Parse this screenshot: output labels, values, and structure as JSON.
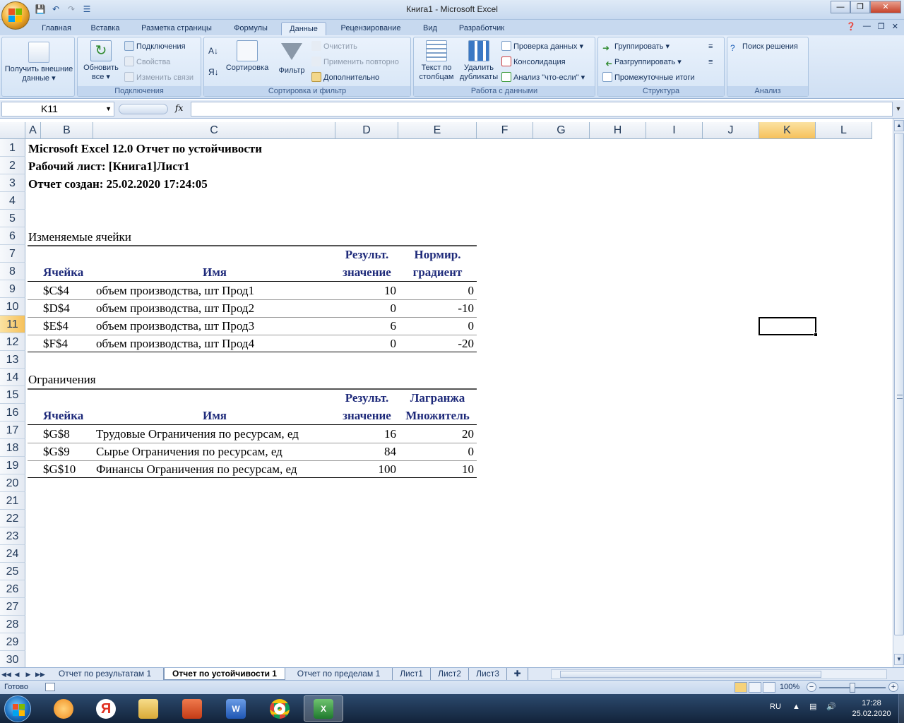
{
  "window": {
    "title": "Книга1 - Microsoft Excel",
    "qat_icons": [
      "save-icon",
      "undo-icon",
      "redo-icon",
      "customize-icon"
    ]
  },
  "ribbon_tabs": [
    "Главная",
    "Вставка",
    "Разметка страницы",
    "Формулы",
    "Данные",
    "Рецензирование",
    "Вид",
    "Разработчик"
  ],
  "active_tab": "Данные",
  "ribbon": {
    "get_external": "Получить внешние данные",
    "refresh_all": "Обновить все",
    "connections": "Подключения",
    "properties": "Свойства",
    "edit_links": "Изменить связи",
    "group_connections": "Подключения",
    "sort": "Сортировка",
    "filter": "Фильтр",
    "clear": "Очистить",
    "reapply": "Применить повторно",
    "advanced": "Дополнительно",
    "group_sort": "Сортировка и фильтр",
    "text_to_columns": "Текст по столбцам",
    "remove_duplicates": "Удалить дубликаты",
    "data_validation": "Проверка данных",
    "consolidate": "Консолидация",
    "what_if": "Анализ \"что-если\"",
    "group_data_tools": "Работа с данными",
    "group": "Группировать",
    "ungroup": "Разгруппировать",
    "subtotal": "Промежуточные итоги",
    "group_outline": "Структура",
    "solver": "Поиск решения",
    "group_analysis": "Анализ"
  },
  "formula_bar": {
    "name_box": "K11",
    "fx": "fx",
    "formula": ""
  },
  "columns": [
    "A",
    "B",
    "C",
    "D",
    "E",
    "F",
    "G",
    "H",
    "I",
    "J",
    "K",
    "L"
  ],
  "selected_column": "K",
  "rows": [
    "1",
    "2",
    "3",
    "4",
    "5",
    "6",
    "7",
    "8",
    "9",
    "10",
    "11",
    "12",
    "13",
    "14",
    "15",
    "16",
    "17",
    "18",
    "19",
    "20",
    "21",
    "22",
    "23",
    "24",
    "25",
    "26",
    "27",
    "28",
    "29",
    "30"
  ],
  "selected_row": "11",
  "report": {
    "title1": "Microsoft Excel 12.0 Отчет по устойчивости",
    "title2": "Рабочий лист: [Книга1]Лист1",
    "title3": "Отчет создан: 25.02.2020 17:24:05",
    "section1": "Изменяемые ячейки",
    "s1_head_d1": "Результ.",
    "s1_head_d2": "значение",
    "s1_head_e1": "Нормир.",
    "s1_head_e2": "градиент",
    "head_cell": "Ячейка",
    "head_name": "Имя",
    "s1_rows": [
      {
        "cell": "$C$4",
        "name": "объем производства, шт Прод1",
        "value": "10",
        "grad": "0"
      },
      {
        "cell": "$D$4",
        "name": "объем производства, шт Прод2",
        "value": "0",
        "grad": "-10"
      },
      {
        "cell": "$E$4",
        "name": "объем производства, шт Прод3",
        "value": "6",
        "grad": "0"
      },
      {
        "cell": "$F$4",
        "name": "объем производства, шт Прод4",
        "value": "0",
        "grad": "-20"
      }
    ],
    "section2": "Ограничения",
    "s2_head_d1": "Результ.",
    "s2_head_d2": "значение",
    "s2_head_e1": "Лагранжа",
    "s2_head_e2": "Множитель",
    "s2_rows": [
      {
        "cell": "$G$8",
        "name": "Трудовые Ограничения по ресурсам, ед",
        "value": "16",
        "mult": "20"
      },
      {
        "cell": "$G$9",
        "name": "Сырье Ограничения по ресурсам, ед",
        "value": "84",
        "mult": "0"
      },
      {
        "cell": "$G$10",
        "name": "Финансы Ограничения по ресурсам, ед",
        "value": "100",
        "mult": "10"
      }
    ]
  },
  "sheet_tabs": [
    "Отчет по результатам 1",
    "Отчет по устойчивости 1",
    "Отчет по пределам 1",
    "Лист1",
    "Лист2",
    "Лист3"
  ],
  "active_sheet": "Отчет по устойчивости 1",
  "status": {
    "ready": "Готово",
    "zoom": "100%"
  },
  "taskbar": {
    "apps": [
      "start-icon",
      "avast-icon",
      "yandex-browser-icon",
      "file-explorer-icon",
      "powerpoint-icon",
      "word-icon",
      "chrome-icon",
      "excel-icon"
    ],
    "lang": "RU",
    "time": "17:28",
    "date": "25.02.2020"
  },
  "colors": {
    "header_text": "#1e2a7a",
    "selected_header": "#f6c15b",
    "ribbon": "#cfdff3"
  }
}
